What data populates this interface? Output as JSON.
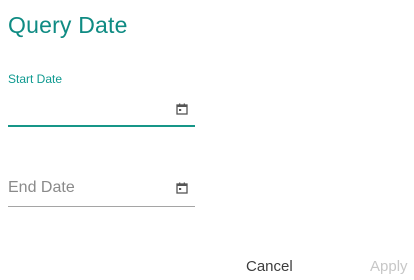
{
  "dialog": {
    "title": "Query Date",
    "start_date": {
      "label": "Start Date",
      "value": ""
    },
    "end_date": {
      "placeholder": "End Date",
      "value": ""
    },
    "icons": {
      "start": "calendar-icon",
      "end": "calendar-icon"
    },
    "buttons": {
      "cancel": "Cancel",
      "apply": "Apply"
    },
    "colors": {
      "accent": "#169688",
      "title": "#0f8b83",
      "disabled": "#c7c7c7"
    }
  }
}
